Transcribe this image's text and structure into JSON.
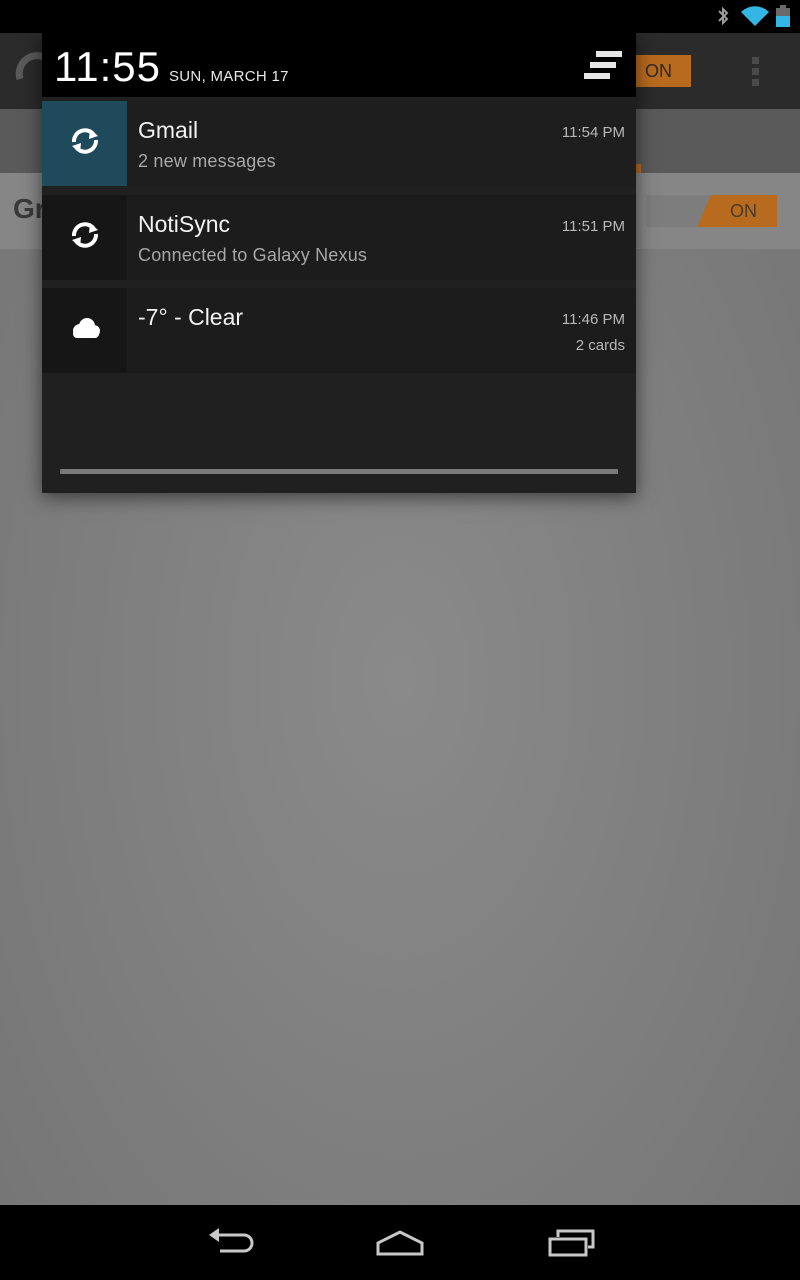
{
  "status_bar": {
    "icons": [
      "bluetooth-icon",
      "wifi-icon",
      "battery-icon"
    ],
    "battery_color": "#33b5e5"
  },
  "shade": {
    "time": "11:55",
    "date": "SUN, MARCH 17",
    "clear_all_icon": "clear-all-icon"
  },
  "notifications": [
    {
      "icon": "sync-icon",
      "title": "Gmail",
      "text": "2 new messages",
      "time": "11:54 PM",
      "accent": "#1f4a5c"
    },
    {
      "icon": "sync-icon",
      "title": "NotiSync",
      "text": "Connected to Galaxy Nexus",
      "time": "11:51 PM"
    },
    {
      "icon": "cloud-icon",
      "title": "-7° - Clear",
      "time": "11:46 PM",
      "info": "2 cards"
    }
  ],
  "background_app": {
    "header_toggle": "ON",
    "row_title": "Gr",
    "row_toggle": "ON",
    "accent": "#b86a1e"
  },
  "nav_bar": {
    "buttons": [
      "back-icon",
      "home-icon",
      "recents-icon"
    ]
  }
}
